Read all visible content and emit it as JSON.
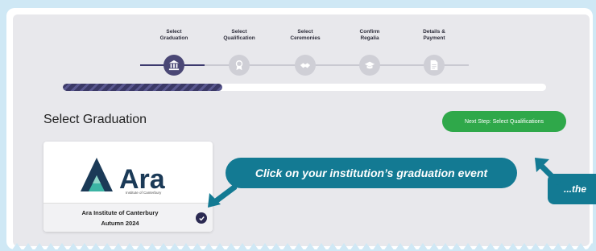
{
  "steps": [
    {
      "label_line1": "Select",
      "label_line2": "Graduation",
      "icon": "bank-icon",
      "active": true
    },
    {
      "label_line1": "Select",
      "label_line2": "Qualification",
      "icon": "award-icon",
      "active": false
    },
    {
      "label_line1": "Select",
      "label_line2": "Ceremonies",
      "icon": "handshake-icon",
      "active": false
    },
    {
      "label_line1": "Confirm",
      "label_line2": "Regalia",
      "icon": "graduation-cap-icon",
      "active": false
    },
    {
      "label_line1": "Details &",
      "label_line2": "Payment",
      "icon": "document-icon",
      "active": false
    }
  ],
  "progress": 0.33,
  "page": {
    "title": "Select Graduation",
    "next_button": "Next Step: Select Qualifications"
  },
  "graduation_card": {
    "logo_text": "Ara",
    "logo_subtext": "Institute of Canterbury",
    "name_line1": "Ara Institute of Canterbury",
    "name_line2": "Autumn 2024",
    "selected": true
  },
  "callouts": {
    "primary": "Click on your institution’s graduation event",
    "secondary": "...the"
  },
  "colors": {
    "active": "#4a4775",
    "accent_green": "#2fa84a",
    "callout_teal": "#137a93",
    "background": "#cfe8f5"
  }
}
